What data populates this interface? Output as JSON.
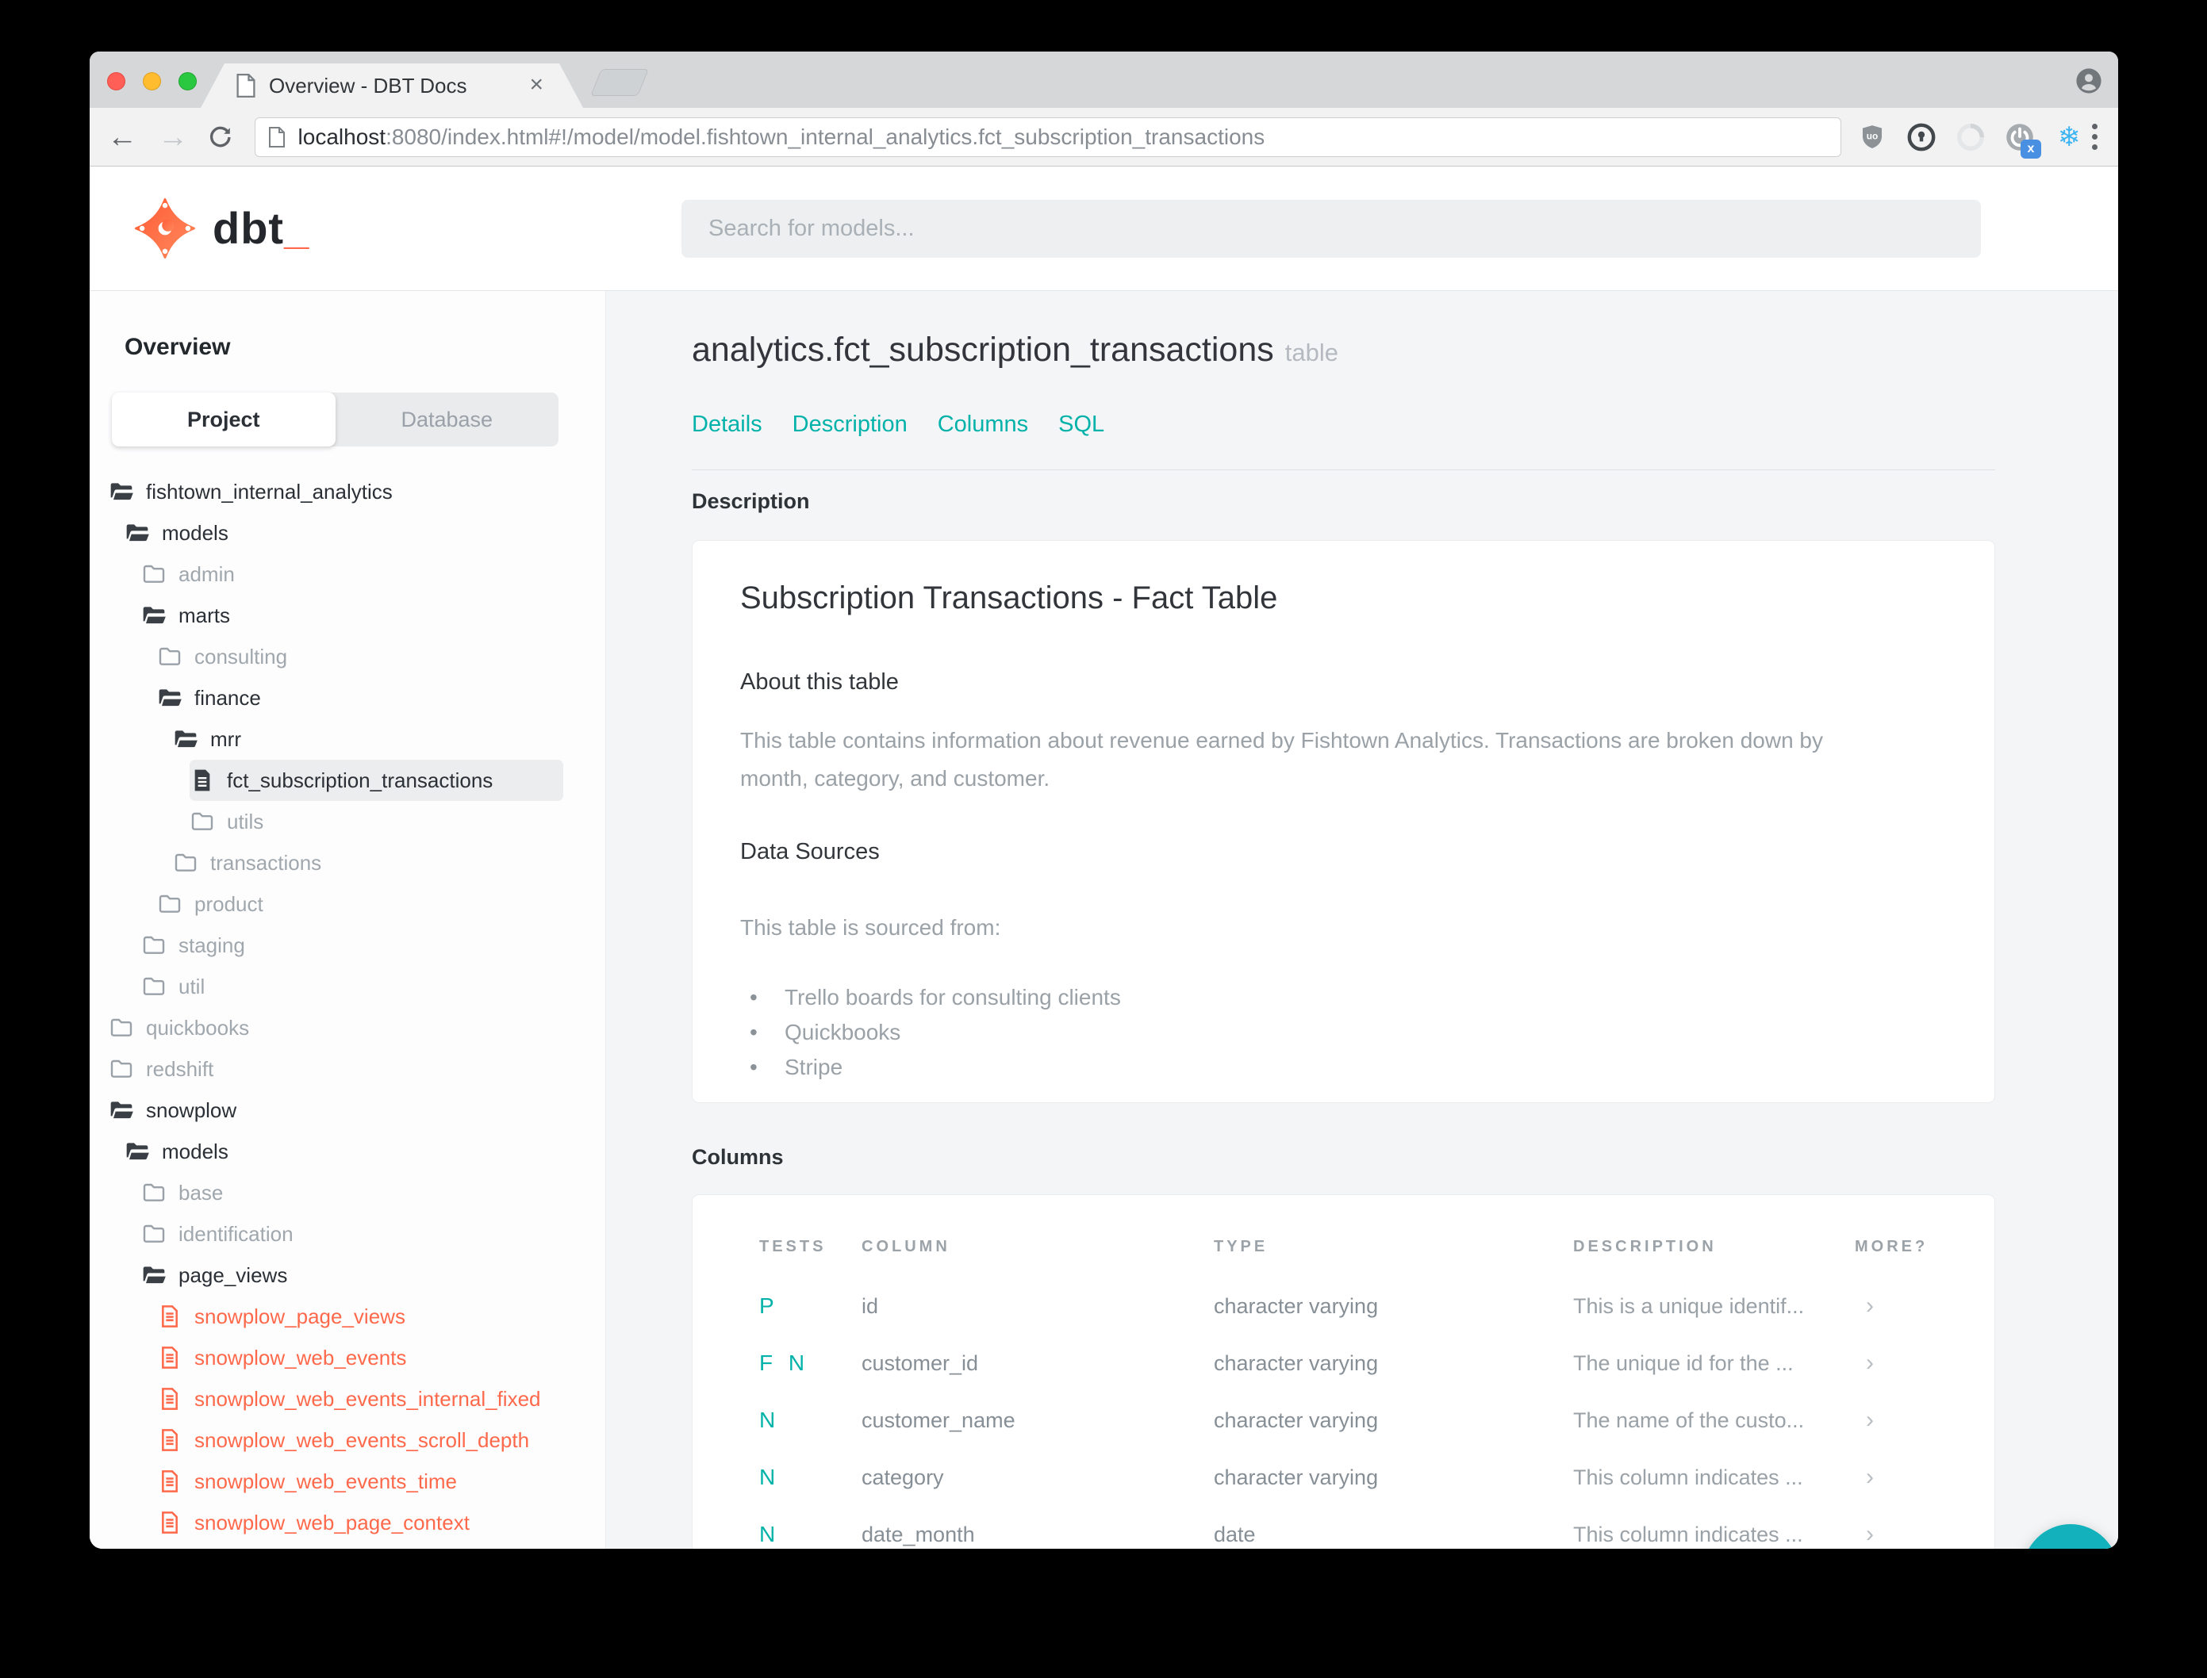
{
  "browser": {
    "tab_title": "Overview - DBT Docs",
    "close_glyph": "×",
    "url_host": "localhost",
    "url_rest": ":8080/index.html#!/model/model.fishtown_internal_analytics.fct_subscription_transactions",
    "back_glyph": "←",
    "forward_glyph": "→",
    "snowflake_glyph": "❄",
    "ublock_label": "uo",
    "badge_label": "x"
  },
  "header": {
    "logo_text": "dbt",
    "logo_underscore": "_",
    "search_placeholder": "Search for models..."
  },
  "sidebar": {
    "heading": "Overview",
    "tabs": {
      "project": "Project",
      "database": "Database"
    },
    "tree": [
      {
        "label": "fishtown_internal_analytics",
        "icon": "folder-open",
        "level": 0,
        "cls": "dark"
      },
      {
        "label": "models",
        "icon": "folder-open",
        "level": 1,
        "cls": "dark"
      },
      {
        "label": "admin",
        "icon": "folder-closed",
        "level": 2,
        "cls": "gray"
      },
      {
        "label": "marts",
        "icon": "folder-open",
        "level": 2,
        "cls": "dark"
      },
      {
        "label": "consulting",
        "icon": "folder-closed",
        "level": 3,
        "cls": "gray"
      },
      {
        "label": "finance",
        "icon": "folder-open",
        "level": 3,
        "cls": "dark"
      },
      {
        "label": "mrr",
        "icon": "folder-open",
        "level": 4,
        "cls": "dark"
      },
      {
        "label": "fct_subscription_transactions",
        "icon": "file",
        "level": 5,
        "cls": "dark selected"
      },
      {
        "label": "utils",
        "icon": "folder-closed",
        "level": 5,
        "cls": "gray"
      },
      {
        "label": "transactions",
        "icon": "folder-closed",
        "level": 4,
        "cls": "gray"
      },
      {
        "label": "product",
        "icon": "folder-closed",
        "level": 3,
        "cls": "gray"
      },
      {
        "label": "staging",
        "icon": "folder-closed",
        "level": 2,
        "cls": "gray"
      },
      {
        "label": "util",
        "icon": "folder-closed",
        "level": 2,
        "cls": "gray"
      },
      {
        "label": "quickbooks",
        "icon": "folder-closed",
        "level": 0,
        "cls": "gray"
      },
      {
        "label": "redshift",
        "icon": "folder-closed",
        "level": 0,
        "cls": "gray"
      },
      {
        "label": "snowplow",
        "icon": "folder-open",
        "level": 0,
        "cls": "dark"
      },
      {
        "label": "models",
        "icon": "folder-open",
        "level": 1,
        "cls": "dark"
      },
      {
        "label": "base",
        "icon": "folder-closed",
        "level": 2,
        "cls": "gray"
      },
      {
        "label": "identification",
        "icon": "folder-closed",
        "level": 2,
        "cls": "gray"
      },
      {
        "label": "page_views",
        "icon": "folder-open",
        "level": 2,
        "cls": "dark"
      },
      {
        "label": "snowplow_page_views",
        "icon": "file-red",
        "level": 3,
        "cls": "red"
      },
      {
        "label": "snowplow_web_events",
        "icon": "file-red",
        "level": 3,
        "cls": "red"
      },
      {
        "label": "snowplow_web_events_internal_fixed",
        "icon": "file-red",
        "level": 3,
        "cls": "red"
      },
      {
        "label": "snowplow_web_events_scroll_depth",
        "icon": "file-red",
        "level": 3,
        "cls": "red"
      },
      {
        "label": "snowplow_web_events_time",
        "icon": "file-red",
        "level": 3,
        "cls": "red"
      },
      {
        "label": "snowplow_web_page_context",
        "icon": "file-red",
        "level": 3,
        "cls": "red"
      }
    ]
  },
  "main": {
    "title": "analytics.fct_subscription_transactions",
    "title_suffix": "table",
    "nav": [
      {
        "label": "Details"
      },
      {
        "label": "Description"
      },
      {
        "label": "Columns"
      },
      {
        "label": "SQL"
      }
    ],
    "description_label": "Description",
    "description_card": {
      "title": "Subscription Transactions - Fact Table",
      "about_heading": "About this table",
      "about_text": "This table contains information about revenue earned by Fishtown Analytics. Transactions are broken down by month, category, and customer.",
      "sources_heading": "Data Sources",
      "sources_intro": "This table is sourced from:",
      "bullet_glyph": "•",
      "sources": [
        {
          "label": "Trello boards for consulting clients"
        },
        {
          "label": "Quickbooks"
        },
        {
          "label": "Stripe"
        }
      ]
    },
    "columns_label": "Columns",
    "table": {
      "headers": {
        "tests": "TESTS",
        "column": "COLUMN",
        "type": "TYPE",
        "description": "DESCRIPTION",
        "more": "MORE?"
      },
      "rows": [
        {
          "tests": "P",
          "column": "id",
          "type": "character varying",
          "description": "This is a unique identif...",
          "more": "›"
        },
        {
          "tests": "F N",
          "column": "customer_id",
          "type": "character varying",
          "description": "The unique id for the ...",
          "more": "›"
        },
        {
          "tests": "N",
          "column": "customer_name",
          "type": "character varying",
          "description": "The name of the custo...",
          "more": "›"
        },
        {
          "tests": "N",
          "column": "category",
          "type": "character varying",
          "description": "This column indicates ...",
          "more": "›"
        },
        {
          "tests": "N",
          "column": "date_month",
          "type": "date",
          "description": "This column indicates ...",
          "more": "›"
        }
      ]
    }
  },
  "colors": {
    "teal": "#00b2a9",
    "fab_teal": "#12b1bc",
    "dbt_orange": "#ff694b",
    "ink": "#2e3338",
    "muted_gray": "#9aa1a7"
  }
}
